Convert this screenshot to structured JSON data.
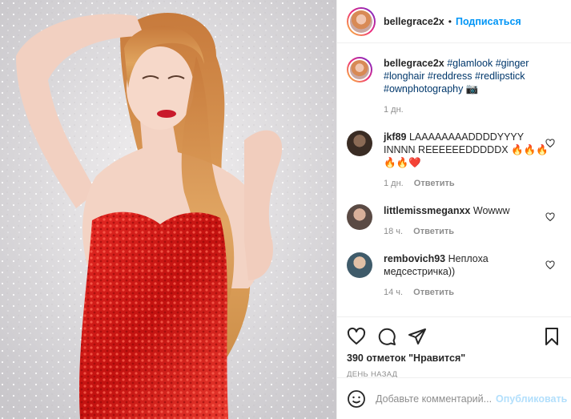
{
  "header": {
    "username": "bellegrace2x",
    "dot": "•",
    "follow_label": "Подписаться"
  },
  "caption": {
    "username": "bellegrace2x",
    "tags": [
      "#glamlook",
      "#ginger",
      "#longhair",
      "#reddress",
      "#redlipstick",
      "#ownphotography"
    ],
    "emoji": "📷",
    "time": "1 дн."
  },
  "comments": [
    {
      "username": "jkf89",
      "text": "LAAAAAAAADDDDYYYY INNNN REEEEEEDDDDDX 🔥🔥🔥🔥🔥❤️",
      "time": "1 дн.",
      "reply": "Ответить"
    },
    {
      "username": "littlemissmeganxx",
      "text": "Wowww",
      "time": "18 ч.",
      "reply": "Ответить"
    },
    {
      "username": "rembovich93",
      "text": "Неплоха медсестричка))",
      "time": "14 ч.",
      "reply": "Ответить"
    }
  ],
  "actions": {
    "likes": "390 отметок \"Нравится\"",
    "date": "День назад"
  },
  "add_comment": {
    "placeholder": "Добавьте комментарий...",
    "publish_label": "Опубликовать"
  },
  "colors": {
    "accent": "#0095f6",
    "hashtag": "#00376b",
    "muted": "#8e8e8e",
    "dress": "#d41a1a",
    "hair": "#d9954f"
  },
  "icons": [
    "heart-icon",
    "comment-icon",
    "share-icon",
    "bookmark-icon",
    "emoji-icon"
  ]
}
